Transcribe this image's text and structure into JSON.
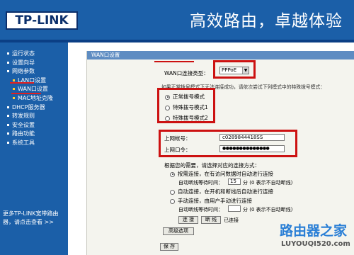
{
  "header": {
    "logo": "TP-LINK",
    "slogan": "高效路由，卓越体验"
  },
  "sidebar": {
    "items": [
      {
        "label": "运行状态"
      },
      {
        "label": "设置向导"
      },
      {
        "label": "网络参数"
      },
      {
        "label": "LAN口设置"
      },
      {
        "label": "WAN口设置"
      },
      {
        "label": "MAC地址克隆"
      },
      {
        "label": "DHCP服务器"
      },
      {
        "label": "转发规则"
      },
      {
        "label": "安全设置"
      },
      {
        "label": "路由功能"
      },
      {
        "label": "系统工具"
      }
    ],
    "more_info": "更多TP-LINK宽带路由器，请点击查看 >>"
  },
  "panel": {
    "title": "WAN口设置",
    "wan_type_label": "WAN口连接类型：",
    "wan_type_value": "PPPoE",
    "dial_hint": "如果正常拨号模式下无法连接成功，请依次尝试下列模式中的特殊拨号模式：",
    "dial_modes": [
      {
        "label": "正常拨号模式",
        "selected": true
      },
      {
        "label": "特殊拨号模式1",
        "selected": false
      },
      {
        "label": "特殊拨号模式2",
        "selected": false
      }
    ],
    "account_label": "上网帐号：",
    "account_value": "c0289844418SS",
    "password_label": "上网口令：",
    "password_value": "●●●●●●●●●●●●●●",
    "conn_mode_label": "根据您的需要，请选择对应的连接方式：",
    "conn_modes": [
      {
        "label": "按需连接，在有访问数据时自动进行连接",
        "selected": true
      },
      {
        "label": "自动连接，在开机和断线后自动进行连接",
        "selected": false
      },
      {
        "label": "手动连接，由用户手动进行连接",
        "selected": false
      }
    ],
    "idle_label_1": "自动断线等待时间：",
    "idle_value_1": "15",
    "idle_unit_1": "分 (0 表示不自动断线)",
    "idle_label_2": "自动断线等待时间：",
    "idle_value_2": "",
    "idle_unit_2": "分 (0 表示不自动断线)",
    "connect_button": "连 接",
    "disconnect_button": "断 线",
    "status_text": "已连接",
    "advanced_button": "高级选项",
    "save_button": "保 存"
  },
  "watermark": {
    "main": "路由器之家",
    "url": "LUYOUQI520.com"
  },
  "colors": {
    "brand_blue": "#1b5fa8",
    "panel_title": "#5e8cc2",
    "highlight_red": "#cc1111",
    "panel_bg": "#f4f4ee"
  }
}
